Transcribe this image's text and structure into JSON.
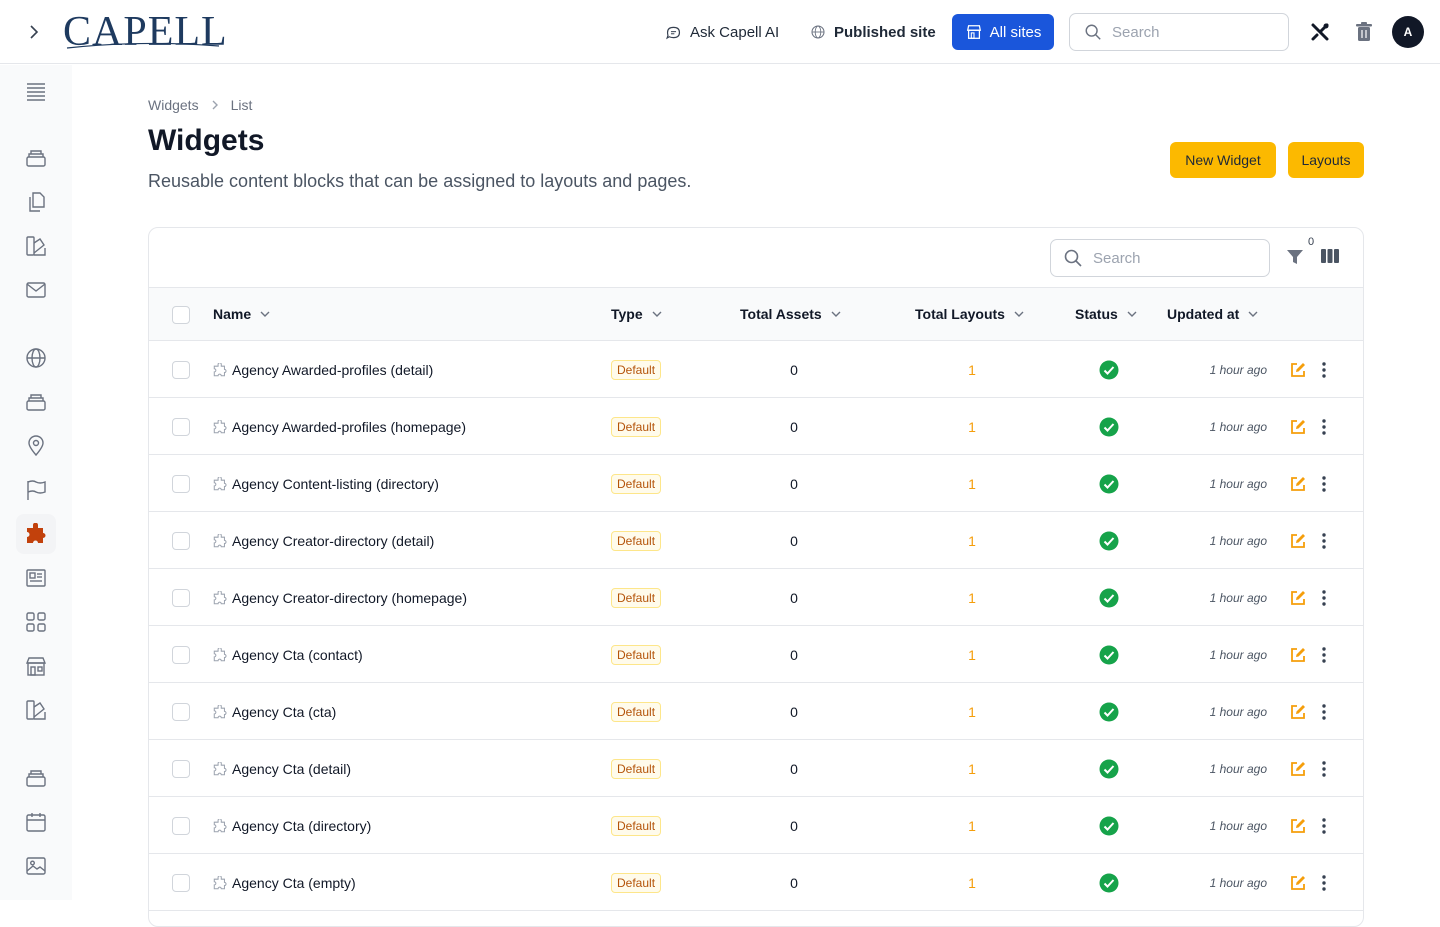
{
  "header": {
    "logo_text": "CAPELL",
    "ask_ai_label": "Ask Capell AI",
    "published_site_label": "Published site",
    "all_sites_label": "All sites",
    "search_placeholder": "Search",
    "avatar_initial": "A"
  },
  "sidebar": {
    "items": [
      {
        "icon": "menu-icon"
      },
      {
        "icon": "archive-icon"
      },
      {
        "icon": "documents-icon"
      },
      {
        "icon": "swatch-icon"
      },
      {
        "icon": "mail-icon"
      },
      {
        "icon": "globe-icon"
      },
      {
        "icon": "archive-icon"
      },
      {
        "icon": "map-pin-icon"
      },
      {
        "icon": "flag-icon"
      },
      {
        "icon": "puzzle-icon",
        "active": true
      },
      {
        "icon": "newspaper-icon"
      },
      {
        "icon": "grid-icon"
      },
      {
        "icon": "store-icon"
      },
      {
        "icon": "swatch-icon"
      },
      {
        "icon": "archive-icon"
      },
      {
        "icon": "calendar-icon"
      },
      {
        "icon": "photo-icon"
      }
    ]
  },
  "breadcrumb": {
    "items": [
      "Widgets",
      "List"
    ]
  },
  "page": {
    "title": "Widgets",
    "subtitle": "Reusable content blocks that can be assigned to layouts and pages.",
    "new_button": "New Widget",
    "layouts_button": "Layouts"
  },
  "table": {
    "search_placeholder": "Search",
    "filter_count": "0",
    "columns": {
      "name": "Name",
      "type": "Type",
      "total_assets": "Total Assets",
      "total_layouts": "Total Layouts",
      "status": "Status",
      "updated_at": "Updated at"
    },
    "rows": [
      {
        "name": "Agency Awarded-profiles (detail)",
        "type": "Default",
        "assets": "0",
        "layouts": "1",
        "updated": "1 hour ago"
      },
      {
        "name": "Agency Awarded-profiles (homepage)",
        "type": "Default",
        "assets": "0",
        "layouts": "1",
        "updated": "1 hour ago"
      },
      {
        "name": "Agency Content-listing (directory)",
        "type": "Default",
        "assets": "0",
        "layouts": "1",
        "updated": "1 hour ago"
      },
      {
        "name": "Agency Creator-directory (detail)",
        "type": "Default",
        "assets": "0",
        "layouts": "1",
        "updated": "1 hour ago"
      },
      {
        "name": "Agency Creator-directory (homepage)",
        "type": "Default",
        "assets": "0",
        "layouts": "1",
        "updated": "1 hour ago"
      },
      {
        "name": "Agency Cta (contact)",
        "type": "Default",
        "assets": "0",
        "layouts": "1",
        "updated": "1 hour ago"
      },
      {
        "name": "Agency Cta (cta)",
        "type": "Default",
        "assets": "0",
        "layouts": "1",
        "updated": "1 hour ago"
      },
      {
        "name": "Agency Cta (detail)",
        "type": "Default",
        "assets": "0",
        "layouts": "1",
        "updated": "1 hour ago"
      },
      {
        "name": "Agency Cta (directory)",
        "type": "Default",
        "assets": "0",
        "layouts": "1",
        "updated": "1 hour ago"
      },
      {
        "name": "Agency Cta (empty)",
        "type": "Default",
        "assets": "0",
        "layouts": "1",
        "updated": "1 hour ago"
      }
    ]
  },
  "colors": {
    "accent": "#1a56db",
    "yellow_button": "#fcb900",
    "status_ok": "#16a34a",
    "edit_icon": "#f59e0b",
    "sidebar_active_icon": "#c2410c"
  }
}
